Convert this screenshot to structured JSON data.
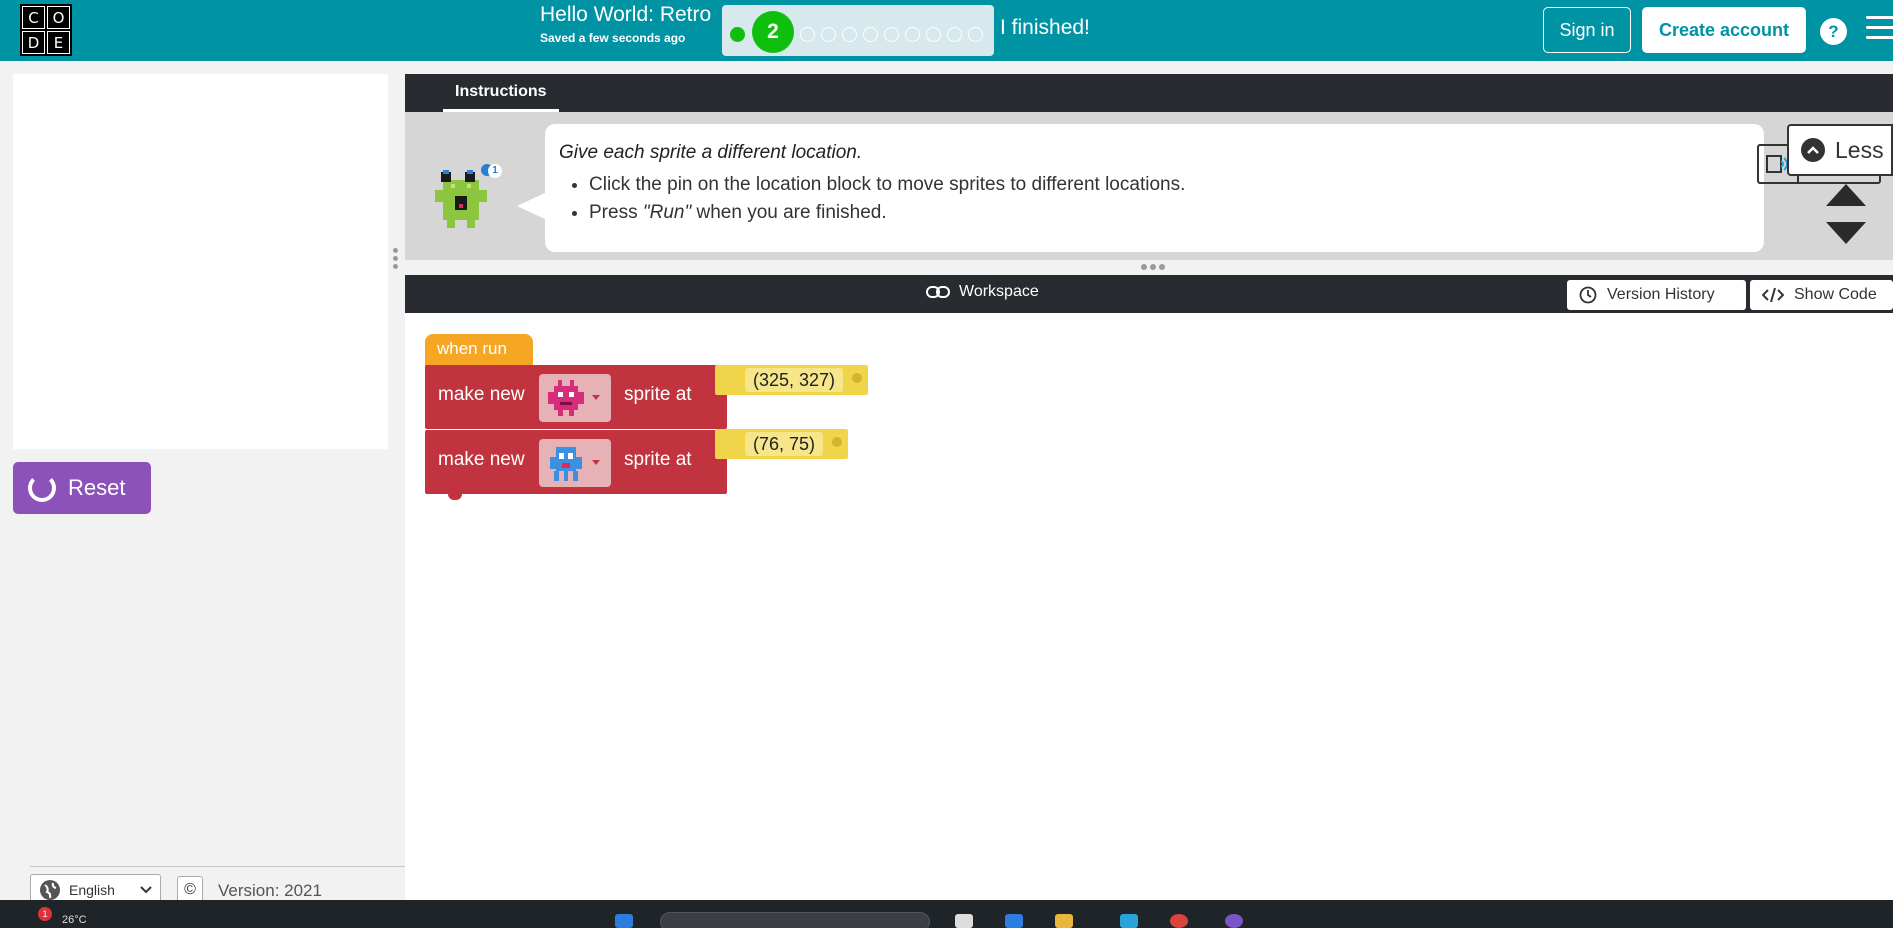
{
  "header": {
    "logo_letters": [
      "C",
      "O",
      "D",
      "E"
    ],
    "project_title": "Hello World: Retro",
    "saved_status": "Saved a few seconds ago",
    "progress": {
      "current_level": "2",
      "completed_levels": 1,
      "total_levels": 11
    },
    "finished_label": "I finished!",
    "sign_in_label": "Sign in",
    "create_account_label": "Create account",
    "help_label": "?",
    "brand_color": "#0093a4"
  },
  "left_panel": {
    "reset_label": "Reset",
    "reset_color": "#8c52ba"
  },
  "instructions": {
    "tab_label": "Instructions",
    "avatar_badge": "1",
    "main_text": "Give each sprite a different location.",
    "bullets": [
      {
        "prefix": "Click the pin on the location block to move sprites to different locations.",
        "emphasis": "",
        "suffix": ""
      },
      {
        "prefix": "Press ",
        "emphasis": "\"Run\"",
        "suffix": " when you are finished."
      }
    ],
    "less_label": "Less"
  },
  "workspace": {
    "title": "Workspace",
    "version_history_label": "Version History",
    "show_code_label": "Show Code",
    "blocks": {
      "hat_label": "when run",
      "rows": [
        {
          "make_label": "make new",
          "sprite_icon": "pink-alien-sprite-icon",
          "at_label": "sprite at",
          "location": "(325, 327)"
        },
        {
          "make_label": "make new",
          "sprite_icon": "blue-alien-sprite-icon",
          "at_label": "sprite at",
          "location": "(76, 75)"
        }
      ],
      "event_color": "#f5a623",
      "block_color": "#c0333f",
      "location_color": "#f0d44a"
    }
  },
  "footer": {
    "language": "English",
    "copyright_symbol": "©",
    "version": "Version: 2021"
  },
  "taskbar": {
    "notification_count": "1",
    "temperature": "26°C"
  }
}
